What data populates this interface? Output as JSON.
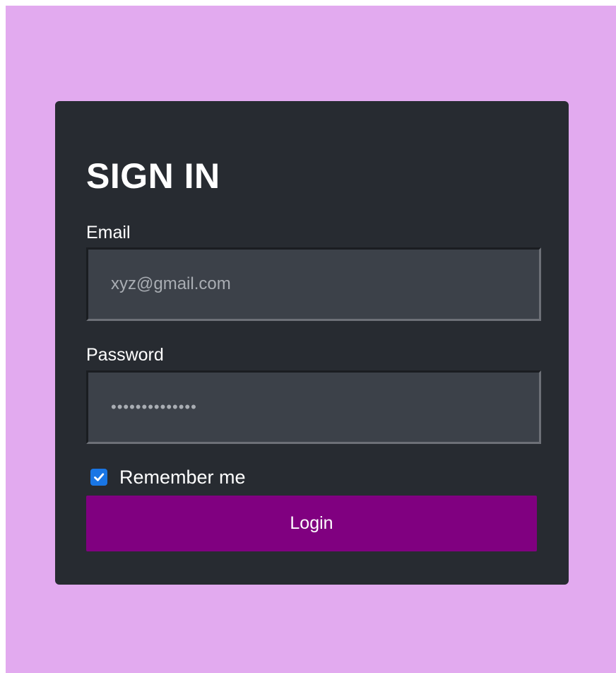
{
  "form": {
    "title": "SIGN IN",
    "email_label": "Email",
    "email_placeholder": "xyz@gmail.com",
    "email_value": "",
    "password_label": "Password",
    "password_value": "••••••••••••••",
    "remember_label": "Remember me",
    "remember_checked": true,
    "login_label": "Login"
  },
  "colors": {
    "page_background": "#e2aaef",
    "card_background": "#272b31",
    "input_background": "#3c4149",
    "button_background": "#800080",
    "checkbox_accent": "#1976e5",
    "text": "#ffffff"
  },
  "icons": {
    "checkbox": "checkmark-icon"
  }
}
